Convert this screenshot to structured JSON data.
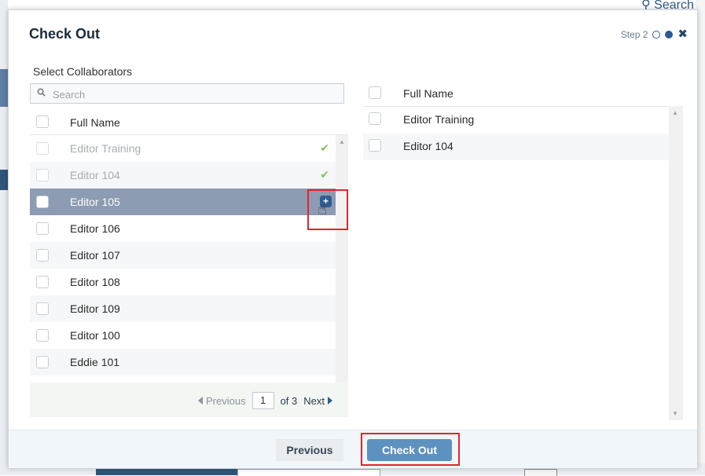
{
  "background": {
    "top_right_search": "Search"
  },
  "modal": {
    "title": "Check Out",
    "step_label": "Step 2",
    "select_label": "Select Collaborators"
  },
  "left_panel": {
    "search_placeholder": "Search",
    "header": "Full Name",
    "rows": [
      {
        "name": "Editor Training",
        "state": "added"
      },
      {
        "name": "Editor 104",
        "state": "added"
      },
      {
        "name": "Editor 105",
        "state": "hover"
      },
      {
        "name": "Editor 106",
        "state": "normal"
      },
      {
        "name": "Editor 107",
        "state": "normal"
      },
      {
        "name": "Editor 108",
        "state": "normal"
      },
      {
        "name": "Editor 109",
        "state": "normal"
      },
      {
        "name": "Editor 100",
        "state": "normal"
      },
      {
        "name": "Eddie 101",
        "state": "normal"
      }
    ],
    "pager": {
      "previous": "Previous",
      "page": "1",
      "of": "of 3",
      "next": "Next"
    }
  },
  "right_panel": {
    "header": "Full Name",
    "rows": [
      "Editor Training",
      "Editor 104"
    ]
  },
  "footer": {
    "previous": "Previous",
    "check_out": "Check Out"
  },
  "colors": {
    "accent": "#2c5c92",
    "primary_button": "#5d92c0",
    "selected_row": "#8d9bb3",
    "check_mark": "#7cc35b",
    "highlight": "#e0262d"
  }
}
